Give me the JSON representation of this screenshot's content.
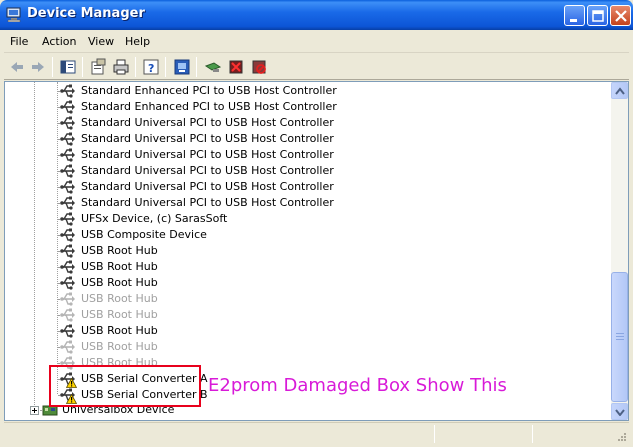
{
  "window": {
    "title": "Device Manager",
    "icons": {
      "app": "computer-icon",
      "minimize": "minimize-icon",
      "maximize": "maximize-icon",
      "close": "close-icon"
    }
  },
  "menu": [
    "File",
    "Action",
    "View",
    "Help"
  ],
  "toolbar": [
    "back-arrow-icon",
    "forward-arrow-icon",
    "show-hide-tree-icon",
    "properties-icon",
    "print-icon",
    "help-icon",
    "display-computer-icon",
    "scan-hardware-icon",
    "uninstall-icon",
    "disable-icon"
  ],
  "tree": {
    "items": [
      "Standard Enhanced PCI to USB Host Controller",
      "Standard Enhanced PCI to USB Host Controller",
      "Standard Universal PCI to USB Host Controller",
      "Standard Universal PCI to USB Host Controller",
      "Standard Universal PCI to USB Host Controller",
      "Standard Universal PCI to USB Host Controller",
      "Standard Universal PCI to USB Host Controller",
      "Standard Universal PCI to USB Host Controller",
      "UFSx Device, (c) SarasSoft",
      "USB Composite Device",
      "USB Root Hub",
      "USB Root Hub",
      "USB Root Hub",
      "USB Root Hub",
      "USB Root Hub",
      "USB Root Hub",
      "USB Root Hub",
      "USB Root Hub",
      "USB Serial Converter A",
      "USB Serial Converter B"
    ],
    "dimmed": [
      13,
      14,
      16,
      17
    ],
    "warning": [
      18,
      19
    ],
    "category": "Universalbox Device"
  },
  "colors": {
    "annotation_box": "#e8001c",
    "annotation_text": "#d81ad8",
    "title_bar": "#0c55d6"
  },
  "annotation": {
    "text": "E2prom Damaged Box Show This"
  }
}
